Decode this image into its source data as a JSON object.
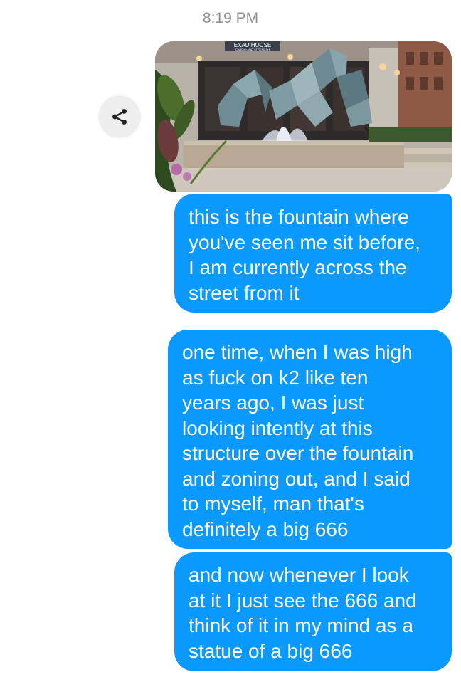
{
  "conversation": {
    "timestamp": "8:19 PM",
    "share_icon": "share-icon",
    "photo": {
      "sign_title": "EXAD HOUSE",
      "sign_subtitle": "CARDIO AND STRENGTH"
    },
    "messages": [
      {
        "lines": [
          "this is the fountain where",
          "you've seen me sit before,",
          "I am currently across the",
          "street from it"
        ]
      },
      {
        "lines": [
          "one time, when I was high",
          "as fuck on k2 like ten",
          "years ago, I was just",
          "looking intently at this",
          "structure over the fountain",
          "and zoning out, and I said",
          "to myself, man that's",
          "definitely a big 666"
        ]
      },
      {
        "lines": [
          "and now whenever I look",
          "at it I just see the 666 and",
          "think of it in my mind as a",
          "statue of a big 666"
        ]
      }
    ]
  },
  "colors": {
    "bubble": "#0a99ff",
    "timestamp": "#8e8e93",
    "share_bg": "#eeeeee"
  }
}
